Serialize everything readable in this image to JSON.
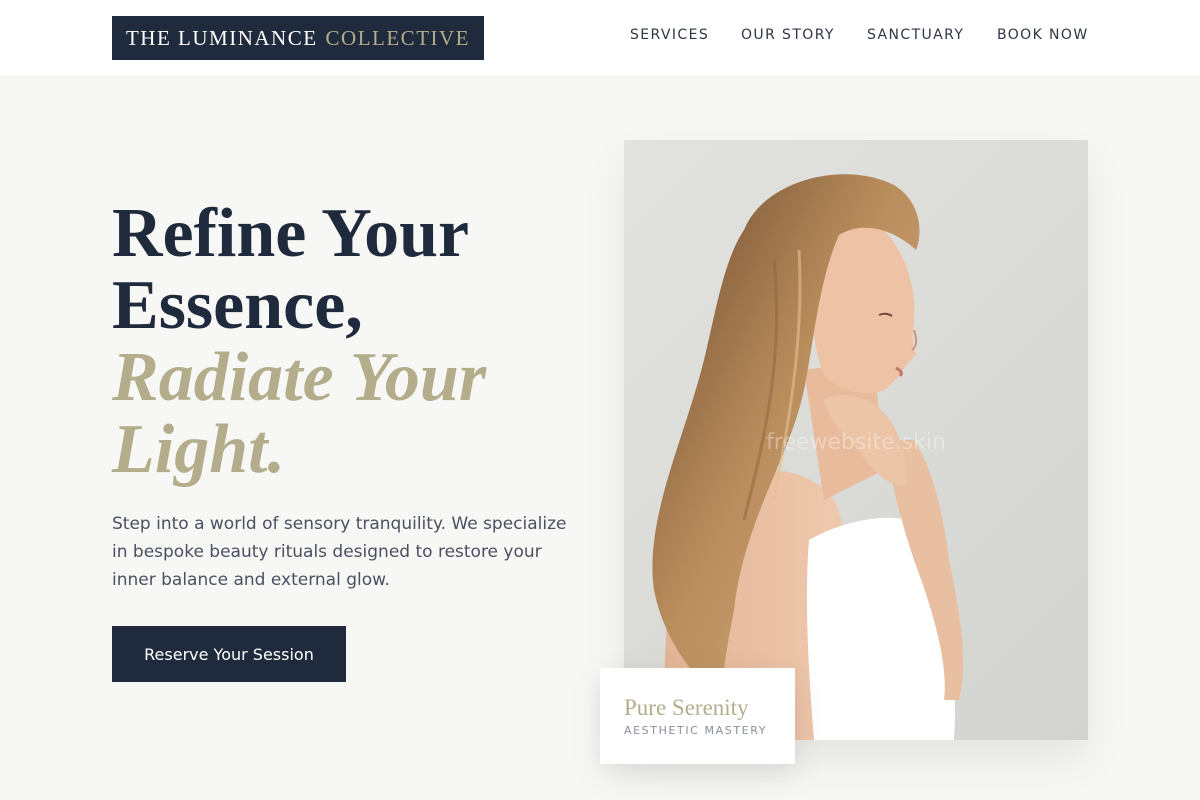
{
  "brand": {
    "name_primary": "THE LUMINANCE",
    "name_accent": "COLLECTIVE"
  },
  "nav": {
    "items": [
      "SERVICES",
      "OUR STORY",
      "SANCTUARY",
      "BOOK NOW"
    ]
  },
  "hero": {
    "title_line1": "Refine Your",
    "title_line2": "Essence,",
    "title_line3": "Radiate Your",
    "title_line4": "Light.",
    "description": "Step into a world of sensory tranquility. We specialize in bespoke beauty rituals designed to restore your inner balance and external glow.",
    "cta_label": "Reserve Your Session"
  },
  "photo": {
    "watermark": "freewebsite.skin"
  },
  "card": {
    "title": "Pure Serenity",
    "subtitle": "AESTHETIC MASTERY"
  },
  "colors": {
    "navy": "#1f2a3d",
    "gold": "#b3ad8c",
    "background": "#f7f8f6"
  }
}
